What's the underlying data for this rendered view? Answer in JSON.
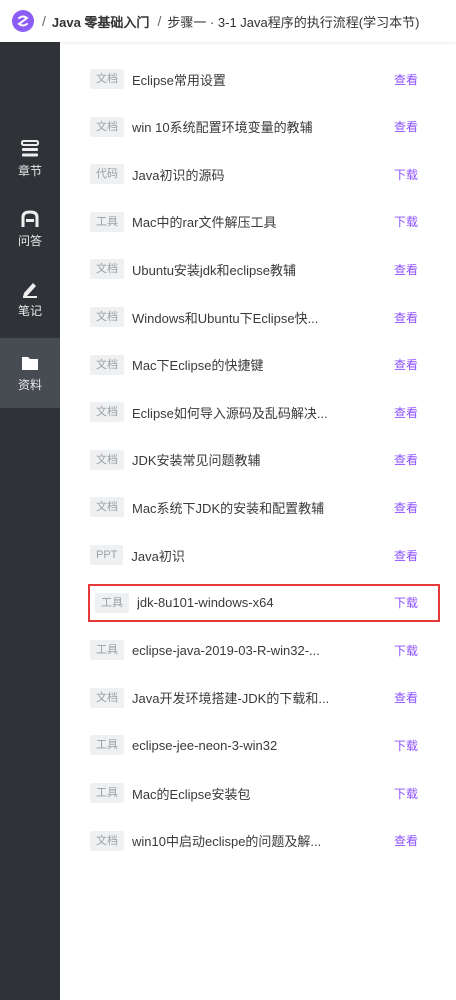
{
  "breadcrumb": {
    "separator": "/",
    "course": "Java 零基础入门",
    "lesson": "步骤一 · 3-1 Java程序的执行流程(学习本节)"
  },
  "sidebar": {
    "items": [
      {
        "label": "章节",
        "icon": "chapter-icon"
      },
      {
        "label": "问答",
        "icon": "qa-icon"
      },
      {
        "label": "笔记",
        "icon": "note-icon"
      },
      {
        "label": "资料",
        "icon": "folder-icon",
        "active": true
      }
    ]
  },
  "resources": [
    {
      "tag": "文档",
      "title": "Eclipse常用设置",
      "action": "查看"
    },
    {
      "tag": "文档",
      "title": "win 10系统配置环境变量的教辅",
      "action": "查看"
    },
    {
      "tag": "代码",
      "title": "Java初识的源码",
      "action": "下载"
    },
    {
      "tag": "工具",
      "title": "Mac中的rar文件解压工具",
      "action": "下载"
    },
    {
      "tag": "文档",
      "title": "Ubuntu安装jdk和eclipse教辅",
      "action": "查看"
    },
    {
      "tag": "文档",
      "title": "Windows和Ubuntu下Eclipse快...",
      "action": "查看"
    },
    {
      "tag": "文档",
      "title": "Mac下Eclipse的快捷键",
      "action": "查看"
    },
    {
      "tag": "文档",
      "title": "Eclipse如何导入源码及乱码解决...",
      "action": "查看"
    },
    {
      "tag": "文档",
      "title": "JDK安装常见问题教辅",
      "action": "查看"
    },
    {
      "tag": "文档",
      "title": "Mac系统下JDK的安装和配置教辅",
      "action": "查看"
    },
    {
      "tag": "PPT",
      "title": "Java初识",
      "action": "查看"
    },
    {
      "tag": "工具",
      "title": "jdk-8u101-windows-x64",
      "action": "下载",
      "highlighted": true
    },
    {
      "tag": "工具",
      "title": "eclipse-java-2019-03-R-win32-...",
      "action": "下载"
    },
    {
      "tag": "文档",
      "title": "Java开发环境搭建-JDK的下载和...",
      "action": "查看"
    },
    {
      "tag": "工具",
      "title": "eclipse-jee-neon-3-win32",
      "action": "下载"
    },
    {
      "tag": "工具",
      "title": "Mac的Eclipse安装包",
      "action": "下载"
    },
    {
      "tag": "文档",
      "title": "win10中启动eclispe的问题及解...",
      "action": "查看"
    }
  ],
  "colors": {
    "accent": "#8c52ff",
    "sidebar_bg": "#2f3337",
    "sidebar_active": "#474c52",
    "highlight_border": "#e5393b",
    "logo": "#8b5cf6"
  }
}
